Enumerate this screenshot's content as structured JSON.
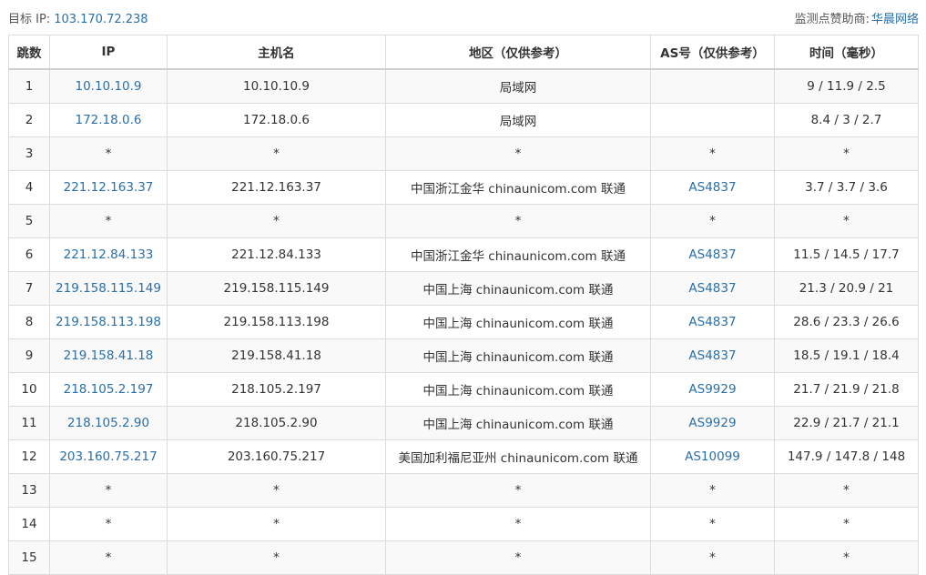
{
  "header": {
    "target_label": "目标 IP:",
    "target_ip": "103.170.72.238",
    "sponsor_label": "监测点赞助商:",
    "sponsor_name": "华晨网络"
  },
  "table": {
    "columns": [
      "跳数",
      "IP",
      "主机名",
      "地区（仅供参考）",
      "AS号（仅供参考）",
      "时间（毫秒）"
    ],
    "rows": [
      {
        "hop": "1",
        "ip": "10.10.10.9",
        "host": "10.10.10.9",
        "region": "局域网",
        "as": "",
        "time": "9 / 11.9 / 2.5"
      },
      {
        "hop": "2",
        "ip": "172.18.0.6",
        "host": "172.18.0.6",
        "region": "局域网",
        "as": "",
        "time": "8.4 / 3 / 2.7"
      },
      {
        "hop": "3",
        "ip": "*",
        "host": "*",
        "region": "*",
        "as": "*",
        "time": "*"
      },
      {
        "hop": "4",
        "ip": "221.12.163.37",
        "host": "221.12.163.37",
        "region": "中国浙江金华 chinaunicom.com 联通",
        "as": "AS4837",
        "time": "3.7 / 3.7 / 3.6"
      },
      {
        "hop": "5",
        "ip": "*",
        "host": "*",
        "region": "*",
        "as": "*",
        "time": "*"
      },
      {
        "hop": "6",
        "ip": "221.12.84.133",
        "host": "221.12.84.133",
        "region": "中国浙江金华 chinaunicom.com 联通",
        "as": "AS4837",
        "time": "11.5 / 14.5 / 17.7"
      },
      {
        "hop": "7",
        "ip": "219.158.115.149",
        "host": "219.158.115.149",
        "region": "中国上海 chinaunicom.com 联通",
        "as": "AS4837",
        "time": "21.3 / 20.9 / 21"
      },
      {
        "hop": "8",
        "ip": "219.158.113.198",
        "host": "219.158.113.198",
        "region": "中国上海 chinaunicom.com 联通",
        "as": "AS4837",
        "time": "28.6 / 23.3 / 26.6"
      },
      {
        "hop": "9",
        "ip": "219.158.41.18",
        "host": "219.158.41.18",
        "region": "中国上海 chinaunicom.com 联通",
        "as": "AS4837",
        "time": "18.5 / 19.1 / 18.4"
      },
      {
        "hop": "10",
        "ip": "218.105.2.197",
        "host": "218.105.2.197",
        "region": "中国上海 chinaunicom.com 联通",
        "as": "AS9929",
        "time": "21.7 / 21.9 / 21.8"
      },
      {
        "hop": "11",
        "ip": "218.105.2.90",
        "host": "218.105.2.90",
        "region": "中国上海 chinaunicom.com 联通",
        "as": "AS9929",
        "time": "22.9 / 21.7 / 21.1"
      },
      {
        "hop": "12",
        "ip": "203.160.75.217",
        "host": "203.160.75.217",
        "region": "美国加利福尼亚州 chinaunicom.com 联通",
        "as": "AS10099",
        "time": "147.9 / 147.8 / 148"
      },
      {
        "hop": "13",
        "ip": "*",
        "host": "*",
        "region": "*",
        "as": "*",
        "time": "*"
      },
      {
        "hop": "14",
        "ip": "*",
        "host": "*",
        "region": "*",
        "as": "*",
        "time": "*"
      },
      {
        "hop": "15",
        "ip": "*",
        "host": "*",
        "region": "*",
        "as": "*",
        "time": "*"
      }
    ]
  },
  "colors": {
    "link": "#2a6fa8",
    "text": "#333333",
    "row_stripe": "#f9f9f9",
    "border": "#dcdcdc"
  }
}
